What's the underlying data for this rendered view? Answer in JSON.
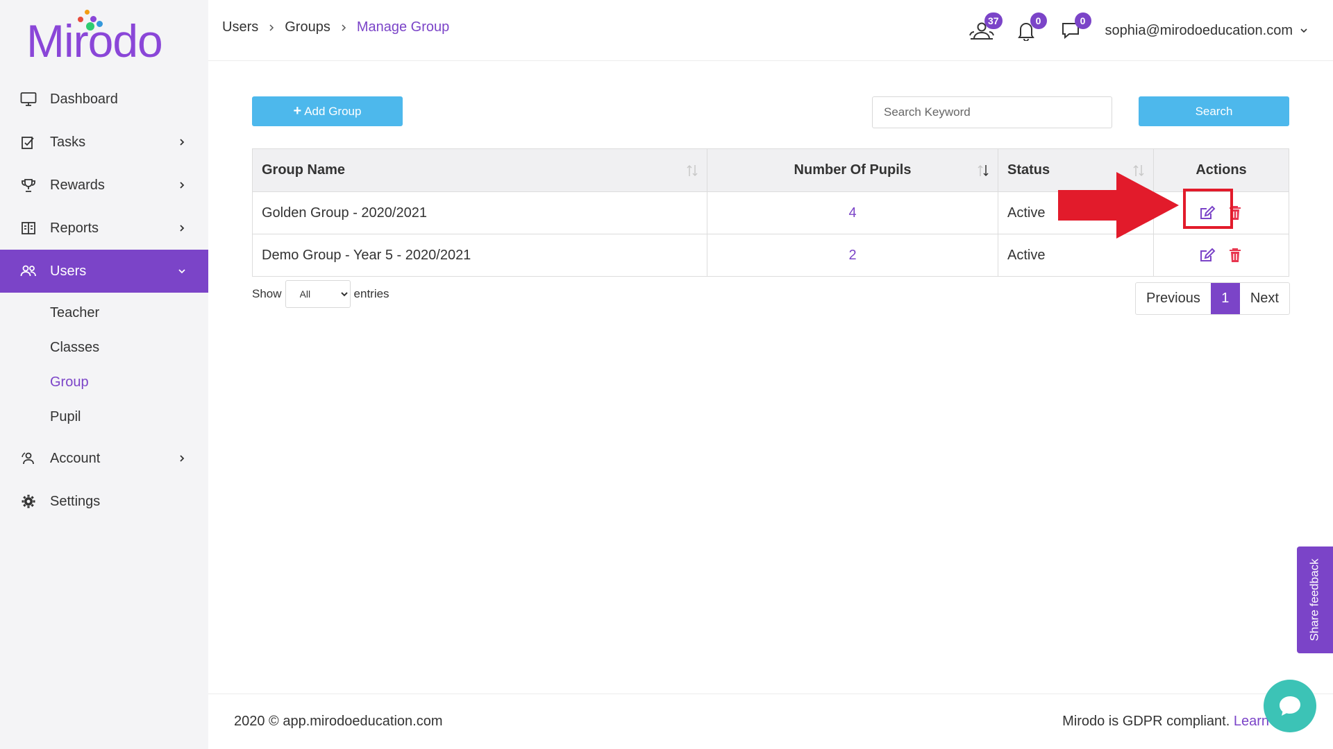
{
  "app": {
    "logo_text": "Mirodo",
    "brand_color": "#7b44c8"
  },
  "sidebar": {
    "items": [
      {
        "label": "Dashboard",
        "icon": "monitor-icon"
      },
      {
        "label": "Tasks",
        "icon": "tasks-icon"
      },
      {
        "label": "Rewards",
        "icon": "trophy-icon"
      },
      {
        "label": "Reports",
        "icon": "reports-icon"
      },
      {
        "label": "Users",
        "icon": "users-icon"
      },
      {
        "label": "Account",
        "icon": "account-icon"
      },
      {
        "label": "Settings",
        "icon": "gear-icon"
      }
    ],
    "users_sub": [
      "Teacher",
      "Classes",
      "Group",
      "Pupil"
    ]
  },
  "breadcrumb": {
    "items": [
      "Users",
      "Groups",
      "Manage Group"
    ]
  },
  "topbar": {
    "students_count": "37",
    "notifications_count": "0",
    "messages_count": "0",
    "user_email": "sophia@mirodoeducation.com"
  },
  "toolbar": {
    "add_label": "Add Group",
    "search_placeholder": "Search Keyword",
    "search_label": "Search"
  },
  "table": {
    "headers": [
      "Group Name",
      "Number Of Pupils",
      "Status",
      "Actions"
    ],
    "rows": [
      {
        "name": "Golden Group - 2020/2021",
        "pupils": "4",
        "status": "Active"
      },
      {
        "name": "Demo Group - Year 5 - 2020/2021",
        "pupils": "2",
        "status": "Active"
      }
    ]
  },
  "pagination": {
    "show_label": "Show",
    "entries_label": "entries",
    "page_size": "All",
    "previous": "Previous",
    "current_page": "1",
    "next": "Next"
  },
  "footer": {
    "copyright": "2020 © app.mirodoeducation.com",
    "gdpr_text": "Mirodo is GDPR compliant.",
    "gdpr_link": "Learn"
  },
  "feedback": {
    "label": "Share feedback"
  },
  "colors": {
    "accent": "#7b44c8",
    "button": "#4db8ec",
    "delete": "#e8364f",
    "annotation": "#e21b2b",
    "chat": "#3cc3b6"
  }
}
